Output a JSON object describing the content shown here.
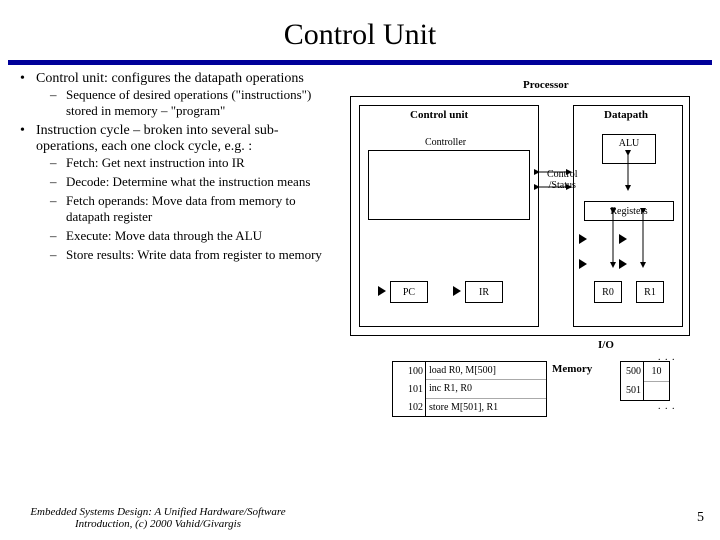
{
  "title": "Control Unit",
  "bullets": [
    {
      "text": "Control unit: configures the datapath operations",
      "sub": [
        "Sequence of desired operations (\"instructions\") stored in memory – \"program\""
      ]
    },
    {
      "text": "Instruction cycle – broken into several sub-operations, each one clock cycle, e.g. :",
      "sub": [
        "Fetch: Get next instruction into IR",
        "Decode: Determine what the instruction means",
        "Fetch operands: Move data from memory to datapath register",
        "Execute: Move data through the ALU",
        "Store results: Write data from register to memory"
      ]
    }
  ],
  "diagram": {
    "processor": "Processor",
    "control_unit": "Control unit",
    "controller": "Controller",
    "datapath": "Datapath",
    "alu": "ALU",
    "registers": "Registers",
    "pc": "PC",
    "ir": "IR",
    "r0": "R0",
    "r1": "R1",
    "ctrl_status": "Control\n/Status",
    "io": "I/O",
    "memory_label": "Memory",
    "program": [
      {
        "addr": "100",
        "instr": "load R0, M[500]"
      },
      {
        "addr": "101",
        "instr": "inc R1, R0"
      },
      {
        "addr": "102",
        "instr": "store M[501], R1"
      }
    ],
    "data_mem": [
      {
        "addr": "500",
        "val": "10"
      },
      {
        "addr": "501",
        "val": ""
      }
    ]
  },
  "footer": "Embedded Systems Design: A Unified Hardware/Software Introduction, (c) 2000 Vahid/Givargis",
  "page": "5"
}
